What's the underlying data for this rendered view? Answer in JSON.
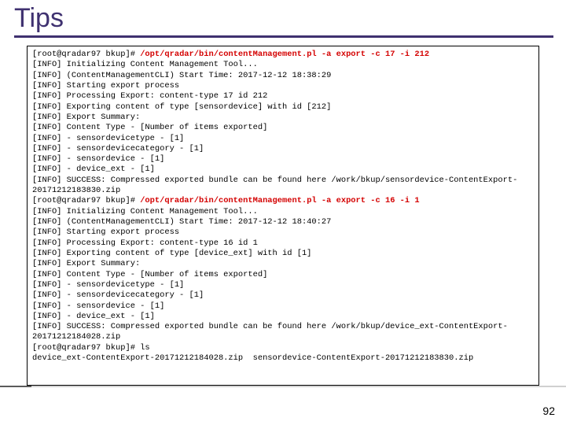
{
  "title": "Tips",
  "page_number": "92",
  "terminal": {
    "prompt1": "[root@qradar97 bkup]# ",
    "cmd1": "/opt/qradar/bin/contentManagement.pl -a export -c 17 -i 212",
    "block1": "[INFO] Initializing Content Management Tool...\n[INFO] (ContentManagementCLI) Start Time: 2017-12-12 18:38:29\n[INFO] Starting export process\n[INFO] Processing Export: content-type 17 id 212\n[INFO] Exporting content of type [sensordevice] with id [212]\n[INFO] Export Summary:\n[INFO] Content Type - [Number of items exported]\n[INFO] - sensordevicetype - [1]\n[INFO] - sensordevicecategory - [1]\n[INFO] - sensordevice - [1]\n[INFO] - device_ext - [1]\n[INFO] SUCCESS: Compressed exported bundle can be found here /work/bkup/sensordevice-ContentExport-20171212183830.zip",
    "prompt2": "[root@qradar97 bkup]# ",
    "cmd2": "/opt/qradar/bin/contentManagement.pl -a export -c 16 -i 1",
    "block2": "[INFO] Initializing Content Management Tool...\n[INFO] (ContentManagementCLI) Start Time: 2017-12-12 18:40:27\n[INFO] Starting export process\n[INFO] Processing Export: content-type 16 id 1\n[INFO] Exporting content of type [device_ext] with id [1]\n[INFO] Export Summary:\n[INFO] Content Type - [Number of items exported]\n[INFO] - sensordevicetype - [1]\n[INFO] - sensordevicecategory - [1]\n[INFO] - sensordevice - [1]\n[INFO] - device_ext - [1]\n[INFO] SUCCESS: Compressed exported bundle can be found here /work/bkup/device_ext-ContentExport-20171212184028.zip",
    "prompt3": "[root@qradar97 bkup]# ls",
    "block3": "device_ext-ContentExport-20171212184028.zip  sensordevice-ContentExport-20171212183830.zip"
  }
}
